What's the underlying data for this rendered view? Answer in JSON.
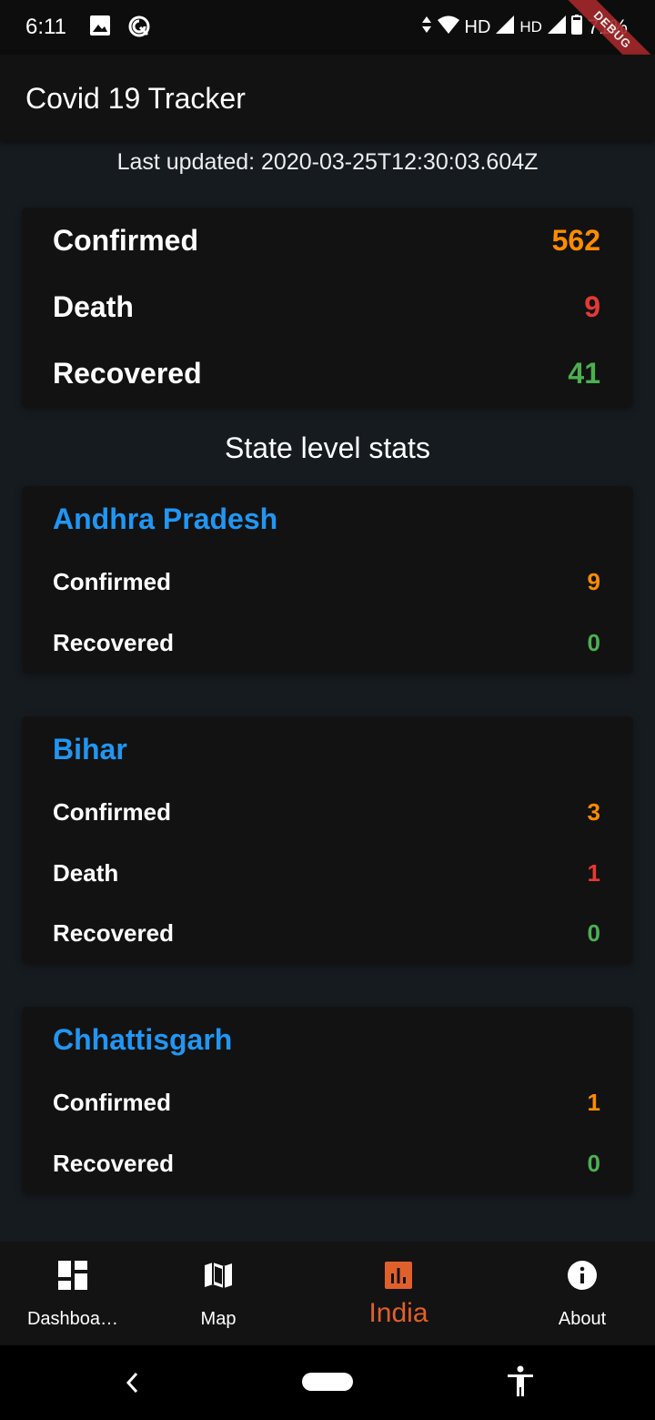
{
  "status_bar": {
    "time": "6:11",
    "network_label_1": "HD",
    "network_label_2": "HD",
    "battery": "71%",
    "debug_banner": "DEBUG"
  },
  "app_bar": {
    "title": "Covid 19 Tracker"
  },
  "last_updated": "Last updated: 2020-03-25T12:30:03.604Z",
  "summary": {
    "confirmed_label": "Confirmed",
    "confirmed_value": "562",
    "death_label": "Death",
    "death_value": "9",
    "recovered_label": "Recovered",
    "recovered_value": "41"
  },
  "section_title": "State level stats",
  "states": [
    {
      "name": "Andhra Pradesh",
      "confirmed_label": "Confirmed",
      "confirmed_value": "9",
      "recovered_label": "Recovered",
      "recovered_value": "0"
    },
    {
      "name": "Bihar",
      "confirmed_label": "Confirmed",
      "confirmed_value": "3",
      "death_label": "Death",
      "death_value": "1",
      "recovered_label": "Recovered",
      "recovered_value": "0"
    },
    {
      "name": "Chhattisgarh",
      "confirmed_label": "Confirmed",
      "confirmed_value": "1",
      "recovered_label": "Recovered",
      "recovered_value": "0"
    }
  ],
  "bottom_nav": {
    "items": [
      {
        "label": "Dashboa…",
        "icon": "dashboard-icon"
      },
      {
        "label": "Map",
        "icon": "map-icon"
      },
      {
        "label": "India",
        "icon": "bar-chart-icon",
        "active": true
      },
      {
        "label": "About",
        "icon": "info-icon"
      }
    ]
  },
  "colors": {
    "confirmed": "#fb8c00",
    "death": "#e53935",
    "recovered": "#4caf50",
    "state_name": "#2196f3",
    "active_tab": "#e0602c"
  }
}
